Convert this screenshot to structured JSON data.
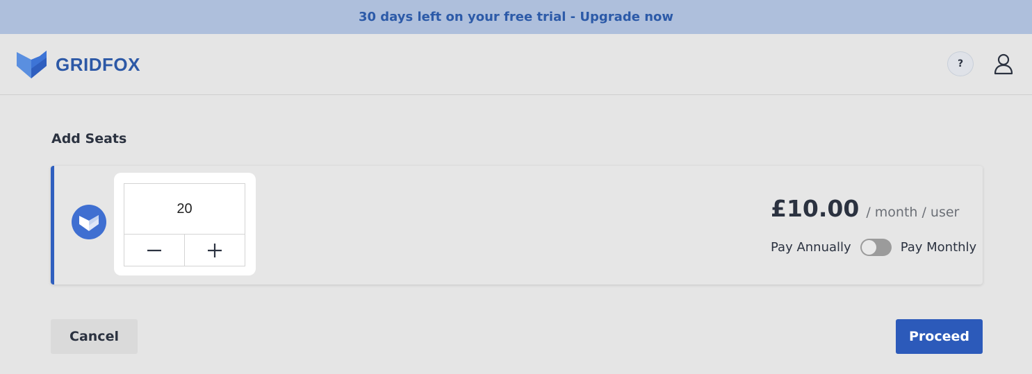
{
  "banner": {
    "text": "30 days left on your free trial - Upgrade now"
  },
  "header": {
    "brand_name": "GRIDFOX",
    "help_label": "?",
    "logo_icon": "gridfox-fox-logo",
    "user_icon": "user-icon"
  },
  "page": {
    "title": "Add Seats"
  },
  "seats": {
    "plan_icon": "gridfox-plan-icon",
    "quantity": "20",
    "decrement_icon": "minus-icon",
    "increment_icon": "plus-icon"
  },
  "pricing": {
    "price": "£10.00",
    "unit": "/ month / user",
    "option_left": "Pay Annually",
    "option_right": "Pay Monthly",
    "monthly_selected": false
  },
  "actions": {
    "cancel_label": "Cancel",
    "proceed_label": "Proceed"
  },
  "colors": {
    "banner_bg": "#aebfdc",
    "accent": "#2c5aba",
    "page_bg": "#e5e5e5"
  }
}
